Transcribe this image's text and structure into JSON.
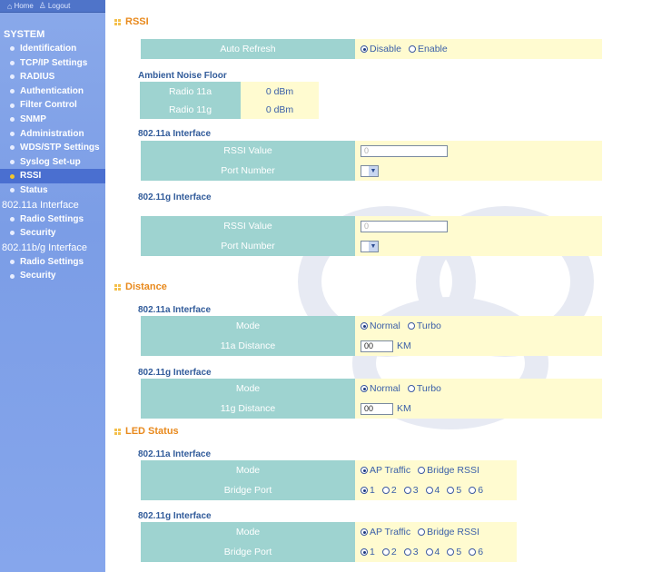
{
  "topbar": {
    "home": "Home",
    "logout": "Logout"
  },
  "sidebar": {
    "system_header": "SYSTEM",
    "system_items": [
      "Identification",
      "TCP/IP Settings",
      "RADIUS",
      "Authentication",
      "Filter Control",
      "SNMP",
      "Administration",
      "WDS/STP Settings",
      "Syslog Set-up",
      "RSSI",
      "Status"
    ],
    "active_item": "RSSI",
    "group_a": "802.11a Interface",
    "group_a_items": [
      "Radio Settings",
      "Security"
    ],
    "group_bg": "802.11b/g Interface",
    "group_bg_items": [
      "Radio Settings",
      "Security"
    ]
  },
  "rssi": {
    "title": "RSSI",
    "auto_refresh_label": "Auto Refresh",
    "auto_refresh_options": [
      "Disable",
      "Enable"
    ],
    "auto_refresh_selected": "Disable",
    "noise_title": "Ambient Noise Floor",
    "noise_rows": [
      {
        "label": "Radio 11a",
        "value": "0 dBm"
      },
      {
        "label": "Radio 11g",
        "value": "0 dBm"
      }
    ],
    "a_title": "802.11a Interface",
    "g_title": "802.11g Interface",
    "rssi_value_label": "RSSI Value",
    "port_number_label": "Port Number",
    "rssi_value_a": "0",
    "rssi_value_g": "0"
  },
  "distance": {
    "title": "Distance",
    "a_title": "802.11a Interface",
    "g_title": "802.11g Interface",
    "mode_label": "Mode",
    "mode_options": [
      "Normal",
      "Turbo"
    ],
    "mode_selected": "Normal",
    "a_distance_label": "11a Distance",
    "g_distance_label": "11g Distance",
    "a_distance_value": "00",
    "g_distance_value": "00",
    "unit": "KM"
  },
  "led": {
    "title": "LED Status",
    "a_title": "802.11a Interface",
    "g_title": "802.11g Interface",
    "mode_label": "Mode",
    "mode_options": [
      "AP Traffic",
      "Bridge RSSI"
    ],
    "mode_selected": "AP Traffic",
    "bridge_port_label": "Bridge Port",
    "bridge_port_options": [
      "1",
      "2",
      "3",
      "4",
      "5",
      "6"
    ],
    "bridge_port_selected": "1"
  }
}
